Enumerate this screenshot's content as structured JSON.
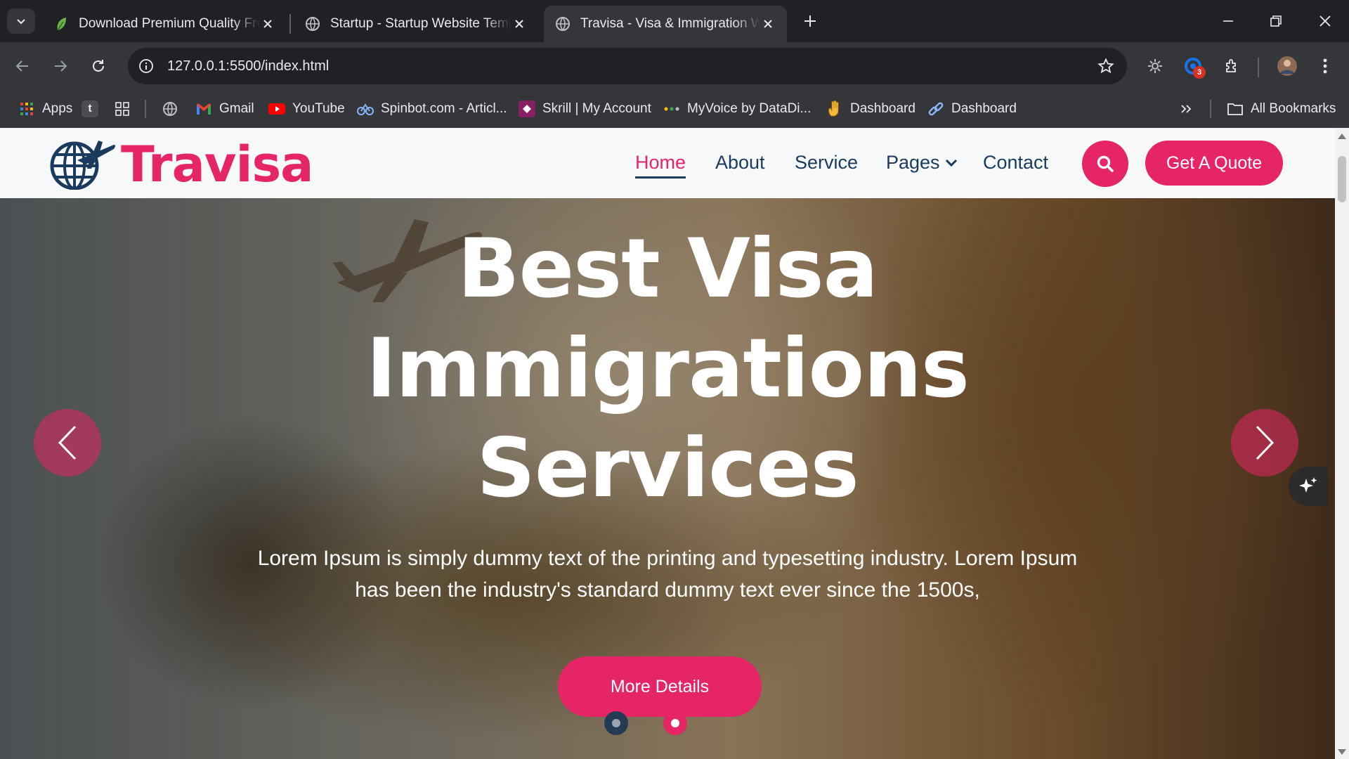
{
  "browser": {
    "tabs": [
      {
        "title": "Download Premium Quality Fre",
        "icon": "leaf-favicon-icon",
        "active": false
      },
      {
        "title": "Startup - Startup Website Temp",
        "icon": "globe-icon",
        "active": false
      },
      {
        "title": "Travisa - Visa & Immigration We",
        "icon": "globe-icon",
        "active": true
      }
    ],
    "url": "127.0.0.1:5500/index.html",
    "extension_badge": "3",
    "bookmarks": [
      {
        "label": "Apps",
        "icon": "apps-grid-icon"
      },
      {
        "label": "",
        "icon": "tumblr-icon"
      },
      {
        "label": "",
        "icon": "grid-icon"
      },
      {
        "label": "",
        "icon": "globe-icon"
      },
      {
        "label": "Gmail",
        "icon": "gmail-icon"
      },
      {
        "label": "YouTube",
        "icon": "youtube-icon"
      },
      {
        "label": "Spinbot.com - Articl...",
        "icon": "spinbot-icon"
      },
      {
        "label": "Skrill | My Account",
        "icon": "skrill-icon"
      },
      {
        "label": "MyVoice by DataDi...",
        "icon": "myvoice-icon"
      },
      {
        "label": "Dashboard",
        "icon": "hand-icon"
      },
      {
        "label": "Dashboard",
        "icon": "link-icon"
      }
    ],
    "all_bookmarks_label": "All Bookmarks",
    "colors": {
      "chrome_dark": "#202124",
      "chrome_mid": "#35363a"
    }
  },
  "site": {
    "brand": "Travisa",
    "nav": {
      "home": "Home",
      "about": "About",
      "service": "Service",
      "pages": "Pages",
      "contact": "Contact",
      "quote": "Get A Quote"
    },
    "hero": {
      "title_lines": [
        "Best Visa",
        "Immigrations",
        "Services"
      ],
      "text_lines": [
        "Lorem Ipsum is simply dummy text of the printing and typesetting industry. Lorem Ipsum",
        "has been the industry's standard dummy text ever since the 1500s,"
      ],
      "button": "More Details",
      "active_slide": 2,
      "slide_count": 2
    },
    "colors": {
      "accent": "#e52565",
      "navy": "#1a3b5d"
    }
  }
}
